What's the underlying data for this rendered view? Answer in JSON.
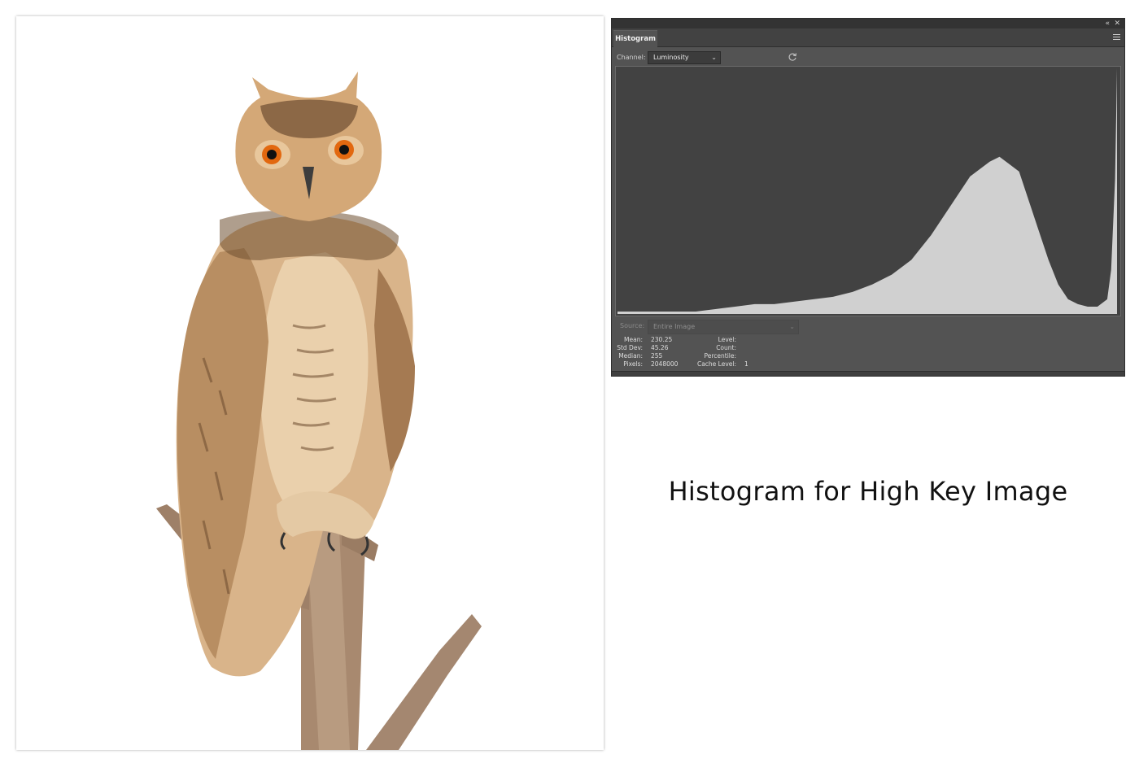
{
  "photo": {
    "subject": "owl-photo",
    "colors": {
      "background": "#ffffff",
      "plumage": "#d9b48a",
      "eyes": "#e2680f",
      "branch": "#a8896f"
    }
  },
  "panel": {
    "tab_label": "Histogram",
    "controls": {
      "collapse_icon": "double-chevron-left-icon",
      "close_icon": "close-icon",
      "menu_icon": "hamburger-menu-icon"
    },
    "channel": {
      "label": "Channel:",
      "value": "Luminosity"
    },
    "refresh_icon": "refresh-icon",
    "source": {
      "label": "Source:",
      "value": "Entire Image"
    },
    "stats": {
      "mean_label": "Mean:",
      "mean_value": "230.25",
      "std_label": "Std Dev:",
      "std_value": "45.26",
      "median_label": "Median:",
      "median_value": "255",
      "pixels_label": "Pixels:",
      "pixels_value": "2048000",
      "level_label": "Level:",
      "level_value": "",
      "count_label": "Count:",
      "count_value": "",
      "percentile_label": "Percentile:",
      "percentile_value": "",
      "cache_label": "Cache Level:",
      "cache_value": "1"
    },
    "colors": {
      "panel": "#535353",
      "graph_bg": "#424242",
      "bars": "#d0d0d0"
    }
  },
  "chart_data": {
    "type": "area",
    "x": [
      0,
      10,
      20,
      30,
      40,
      50,
      60,
      70,
      80,
      90,
      100,
      110,
      120,
      130,
      140,
      150,
      160,
      170,
      180,
      190,
      195,
      200,
      205,
      210,
      215,
      220,
      225,
      230,
      235,
      240,
      245,
      250,
      252,
      254,
      255
    ],
    "values": [
      1,
      1,
      1,
      1,
      1,
      2,
      3,
      4,
      4,
      5,
      6,
      7,
      9,
      12,
      16,
      22,
      32,
      44,
      56,
      62,
      64,
      61,
      58,
      46,
      34,
      22,
      12,
      6,
      4,
      3,
      3,
      6,
      18,
      55,
      100
    ],
    "xlim": [
      0,
      255
    ],
    "ylim": [
      0,
      100
    ]
  },
  "caption": "Histogram for High Key Image"
}
